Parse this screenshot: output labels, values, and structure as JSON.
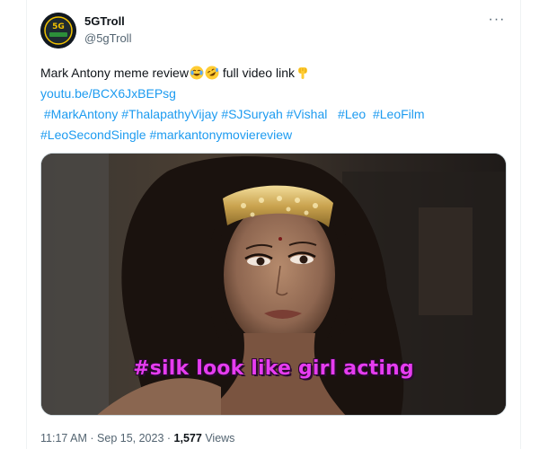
{
  "author": {
    "avatar_text": "5G",
    "name": "5GTroll",
    "handle": "@5gTroll"
  },
  "more_label": "···",
  "tweet": {
    "text": "Mark Antony meme review",
    "text_after_emojis": " full video link",
    "emojis": [
      "face-with-tears-of-joy",
      "rolling-on-floor-laughing",
      "backhand-index-pointing-down"
    ],
    "link": "youtu.be/BCX6JxBEPsg",
    "hashtags_line1": [
      "#MarkAntony",
      "#ThalapathyVijay",
      "#SJSuryah",
      "#Vishal",
      "#Leo",
      "#LeoFilm"
    ],
    "hashtags_line2": [
      "#LeoSecondSingle",
      "#markantonymoviereview"
    ]
  },
  "media": {
    "caption": "#silk look like girl acting"
  },
  "meta": {
    "time": "11:17 AM",
    "separator": "·",
    "date": "Sep 15, 2023",
    "views_count": "1,577",
    "views_label": "Views"
  },
  "colors": {
    "link": "#1d9bf0",
    "secondary_text": "#536471",
    "caption": "#e63cf0"
  }
}
